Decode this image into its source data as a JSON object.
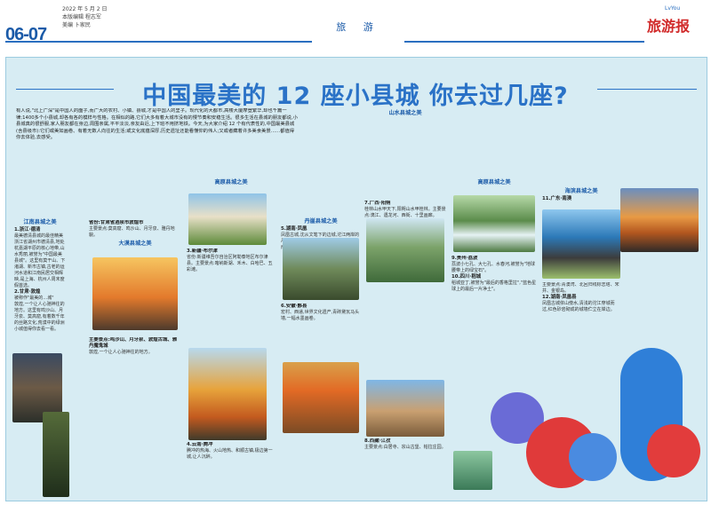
{
  "header": {
    "pages": "06-07",
    "date": "2022 年 5 月 2 日",
    "editor": "本版编辑  程志军",
    "designer": "美编  卜家民",
    "section": "旅 游",
    "brand_en": "LvYou",
    "brand": "旅游报"
  },
  "article": {
    "title": "中国最美的 12 座小县城 你去过几座?",
    "intro": "有人说,\"北上广深\"是中国人的面子,而广大的农村、小镇、县城,才是中国人的里子。现代化的大都市,高楼大厦摩登繁华,却也千篇一律;1400多个小县城,却各有各的模样与性格。在相似的路,它们大多有着大城市没有的慢节奏和安稳生活。很多生活在县城的朋友都说,小县城真的很舒服,家人朋友都在身边,周围亲属,平平淡淡,亲友由近,上下班不用挤地铁。今天,为大家介绍 12 个有代表性的,中国最美县城(含县级市):它们或美如画卷、有着无数人向往的生活;或文化底蕴深厚,历史遗址还能看懂仰的伟人;又或者藏着许多美食美景……都值得你去体验,去感受。"
  },
  "col1": {
    "section": "江南县城之美",
    "items": [
      {
        "head": "1.浙江·德清",
        "sub": "最美德清县城的最佳精美",
        "text": "浙江省湖州市德清县,地处杭嘉湖平原的核心地带,山水秀丽,被誉为\"中国最美县城\"。这里有莫干山、下渚湖、新市古镇,古老的运河水道和江南民居交相辉映,是上海、杭州人周末度假首选。"
      },
      {
        "head": "2.甘肃·敦煌",
        "sub": "被称作\"最美的…城\"",
        "text": "敦煌,一个让人心驰神往的地方。这里有鸣沙山、月牙泉、莫高窟,有着数千年的丝路文化,荒漠中的绿洲小城值得你去看一看。"
      }
    ]
  },
  "col2": {
    "section": "大漠县城之美",
    "blocks": [
      {
        "head": "省份:甘肃省酒泉市敦煌市",
        "text": "主要景点:莫高窟、鸣沙山、月牙泉、雅丹地貌。"
      },
      {
        "head": "主要景点:鸣沙山、月牙泉、敦煌古城、雅丹魔鬼城",
        "text": "敦煌,一个让人心驰神往的地方。"
      }
    ]
  },
  "col3": {
    "section": "高原县城之美",
    "blocks": [
      {
        "head": "3.新疆·布尔津",
        "text": "省份:新疆维吾尔自治区阿勒泰地区布尔津县。主要景点:喀纳斯湖、禾木、白哈巴、五彩滩。"
      },
      {
        "head": "4.云南·腾冲",
        "text": "腾冲的热海、火山地热、和顺古镇,极边第一城,让人沉醉。"
      }
    ]
  },
  "col4": {
    "section": "丹崖县城之美",
    "blocks": [
      {
        "head": "5.湖南·凤凰",
        "text": "凤凰古城,沈从文笔下的边城,沱江两岸的吊脚楼灯火辉煌。主要景点:凤凰古城、南方长城、沱江。"
      },
      {
        "head": "6.安徽·黟县",
        "text": "宏村、西递,世界文化遗产,青砖黛瓦马头墙,一幅水墨画卷。"
      }
    ]
  },
  "col5": {
    "section": "山水县城之美",
    "blocks": [
      {
        "head": "7.广西·阳朔",
        "text": "桂林山水甲天下,阳朔山水甲桂林。主要景点:漓江、遇龙河、西街、十里画廊。"
      },
      {
        "head": "8.西藏·江孜",
        "text": "主要景点:白居寺、宗山古堡、帕拉庄园。"
      }
    ]
  },
  "col6": {
    "section": "高原县城之美",
    "blocks": [
      {
        "head": "9.贵州·荔波",
        "text": "荔波小七孔、大七孔、水春河,被誉为\"地球腰带上的绿宝石\"。"
      },
      {
        "head": "10.四川·稻城",
        "text": "稻城亚丁,被誉为\"最后的香格里拉\",\"蓝色星球上的最后一片净土\"。"
      }
    ]
  },
  "col7": {
    "section": "海滨县城之美",
    "blocks": [
      {
        "head": "11.广东·南澳",
        "text": "主要景点:青澳湾、北回归线标志塔、宋井、金银岛。"
      },
      {
        "head": "12.湖南·凤凰县",
        "text": "凤凰古城依山傍水,清浅的沱江穿城而过,红色砂岩砌成的城墙伫立在岸边。"
      }
    ]
  }
}
